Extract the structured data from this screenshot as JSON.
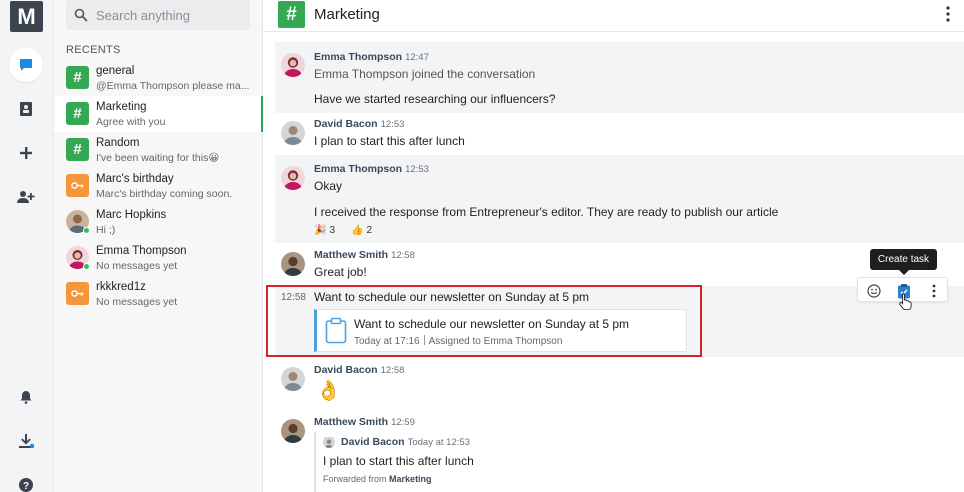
{
  "app": {
    "logo_letter": "M"
  },
  "search": {
    "placeholder": "Search anything"
  },
  "recents": {
    "heading": "RECENTS",
    "items": [
      {
        "name": "general",
        "sub": "@Emma Thompson please ma...",
        "kind": "hash"
      },
      {
        "name": "Marketing",
        "sub": "Agree with you",
        "kind": "hash",
        "active": true
      },
      {
        "name": "Random",
        "sub": "I've been waiting for this😀",
        "kind": "hash"
      },
      {
        "name": "Marc's birthday",
        "sub": "Marc's birthday coming soon.",
        "kind": "key"
      },
      {
        "name": "Marc Hopkins",
        "sub": "Hi ;)",
        "kind": "person"
      },
      {
        "name": "Emma Thompson",
        "sub": "No messages yet",
        "kind": "person"
      },
      {
        "name": "rkkkred1z",
        "sub": "No messages yet",
        "kind": "key"
      }
    ]
  },
  "channel": {
    "title": "Marketing"
  },
  "messages": {
    "m1": {
      "author": "Emma Thompson",
      "time": "12:47",
      "lines": [
        "Emma Thompson joined the conversation",
        "Have we started researching our influencers?"
      ]
    },
    "m2": {
      "author": "David Bacon",
      "time": "12:53",
      "text": "I plan to start this after lunch"
    },
    "m3": {
      "author": "Emma Thompson",
      "time": "12:53",
      "lines": [
        "Okay",
        "I received the response from Entrepreneur's editor. They are ready to publish our article"
      ],
      "reactions": [
        {
          "emoji": "🎉",
          "count": "3"
        },
        {
          "emoji": "👍",
          "count": "2"
        }
      ]
    },
    "m4": {
      "author": "Matthew Smith",
      "time": "12:58",
      "text": "Great job!"
    },
    "m5": {
      "time": "12:58",
      "text": "Want to schedule our newsletter on Sunday at 5 pm",
      "task": {
        "title": "Want to schedule our newsletter on Sunday at 5 pm",
        "date": "Today at 17:16",
        "assigned": "Assigned to Emma Thompson"
      }
    },
    "m6": {
      "author": "David Bacon",
      "time": "12:58",
      "emoji": "👌"
    },
    "m7": {
      "author": "Matthew Smith",
      "time": "12:59",
      "forward": {
        "author": "David Bacon",
        "time": "Today at 12:53",
        "text": "I plan to start this after lunch",
        "from_label": "Forwarded from",
        "from_channel": "Marketing"
      }
    }
  },
  "tooltip": {
    "text": "Create task"
  },
  "colors": {
    "accent_green": "#34a853",
    "highlight_red": "#d9232c",
    "task_blue": "#4aa3df"
  }
}
